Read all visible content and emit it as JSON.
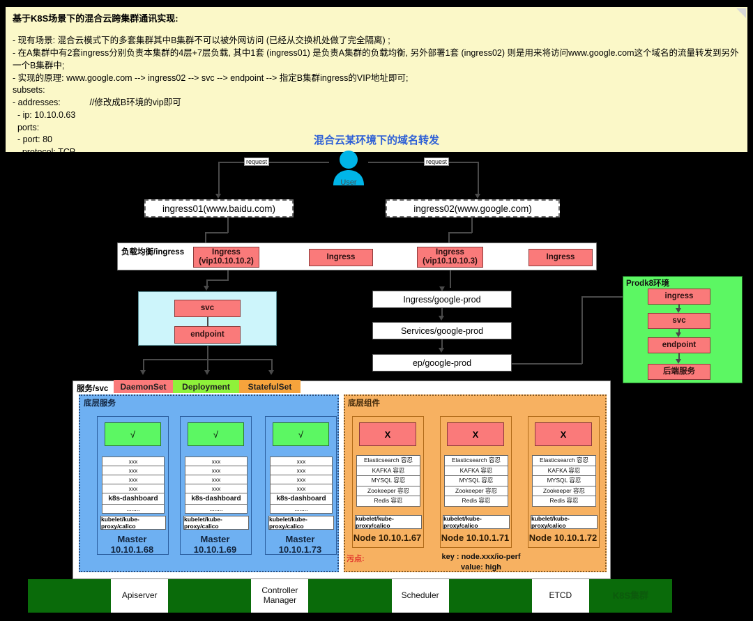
{
  "note": {
    "heading": "基于K8S场景下的混合云跨集群通讯实现:",
    "lines": [
      "- 现有场景: 混合云模式下的多套集群其中B集群不可以被外网访问 (已经从交换机处做了完全隔离) ;",
      "- 在A集群中有2套ingress分别负责本集群的4层+7层负载, 其中1套 (ingress01) 是负责A集群的负载均衡, 另外部署1套 (ingress02) 则是用来将访问www.google.com这个域名的流量转发到另外一个B集群中;",
      "- 实现的原理: www.google.com --> ingress02 --> svc --> endpoint --> 指定B集群ingress的VIP地址即可;",
      "subsets:",
      "- addresses:            //修改成B环境的vip即可",
      "  - ip: 10.10.0.63",
      "  ports:",
      "  - port: 80",
      "    protocol: TCP"
    ]
  },
  "diagram_title": "混合云某环境下的域名转发",
  "user": {
    "label": "User",
    "color": "#00b5e8"
  },
  "requests": {
    "left_label": "request",
    "right_label": "request"
  },
  "ingress_entries": [
    {
      "label": "ingress01(www.baidu.com)"
    },
    {
      "label": "ingress02(www.google.com)"
    }
  ],
  "lb_strip": {
    "label": "负载均衡/ingress",
    "items": [
      {
        "line1": "Ingress",
        "line2": "(vip10.10.10.2)"
      },
      {
        "line1": "Ingress",
        "line2": ""
      },
      {
        "line1": "Ingress",
        "line2": "(vip10.10.10.3)"
      },
      {
        "line1": "Ingress",
        "line2": ""
      }
    ]
  },
  "cyan_group": {
    "svc": "svc",
    "endpoint": "endpoint",
    "bg": "#cdf5fb"
  },
  "google_chain": [
    {
      "label": "Ingress/google-prod"
    },
    {
      "label": "Services/google-prod"
    },
    {
      "label": "ep/google-prod"
    }
  ],
  "prod_env": {
    "label": "Prodk8环境",
    "bg": "#5cf763",
    "items": [
      "ingress",
      "svc",
      "endpoint",
      "后端服务"
    ]
  },
  "workload_tags": [
    {
      "label": "DaemonSet",
      "color": "#fa7a7a"
    },
    {
      "label": "Deployment",
      "color": "#8ef13a"
    },
    {
      "label": "StatefulSet",
      "color": "#f6a33c"
    }
  ],
  "svc_panel": {
    "label": "服务/svc"
  },
  "blue_panel": {
    "label": "底层服务",
    "bg": "#6eb0f2",
    "nodes": [
      {
        "status": "√",
        "stack": [
          "xxx",
          "xxx",
          "xxx",
          "xxx",
          "k8s-dashboard",
          "........"
        ],
        "agents": "kubelet/kube-proxy/calico",
        "name": "Master 10.10.1.68"
      },
      {
        "status": "√",
        "stack": [
          "xxx",
          "xxx",
          "xxx",
          "xxx",
          "k8s-dashboard",
          "........"
        ],
        "agents": "kubelet/kube-proxy/calico",
        "name": "Master 10.10.1.69"
      },
      {
        "status": "√",
        "stack": [
          "xxx",
          "xxx",
          "xxx",
          "xxx",
          "k8s-dashboard",
          "........"
        ],
        "agents": "kubelet/kube-proxy/calico",
        "name": "Master 10.10.1.73"
      }
    ]
  },
  "orange_panel": {
    "label": "底层组件",
    "bg": "#f7b161",
    "nodes": [
      {
        "status": "X",
        "stack": [
          "Elasticsearch 容忍",
          "KAFKA 容忍",
          "MYSQL 容忍",
          "Zookeeper 容忍",
          "Redis 容忍"
        ],
        "agents": "kubelet/kube-proxy/calico",
        "name": "Node 10.10.1.67"
      },
      {
        "status": "X",
        "stack": [
          "Elasticsearch 容忍",
          "KAFKA 容忍",
          "MYSQL 容忍",
          "Zookeeper 容忍",
          "Redis 容忍"
        ],
        "agents": "kubelet/kube-proxy/calico",
        "name": "Node 10.10.1.71"
      },
      {
        "status": "X",
        "stack": [
          "Elasticsearch 容忍",
          "KAFKA 容忍",
          "MYSQL 容忍",
          "Zookeeper 容忍",
          "Redis 容忍"
        ],
        "agents": "kubelet/kube-proxy/calico",
        "name": "Node 10.10.1.72"
      }
    ],
    "taint_label": "污点:",
    "taint_key": "key : node.xxx/io-perf",
    "taint_value": "value:  high"
  },
  "bottom_bar": {
    "bg": "#0a6b0a",
    "items": [
      "Apiserver",
      "Controller Manager",
      "Scheduler",
      "ETCD"
    ],
    "cluster_label": "K8S集群"
  }
}
